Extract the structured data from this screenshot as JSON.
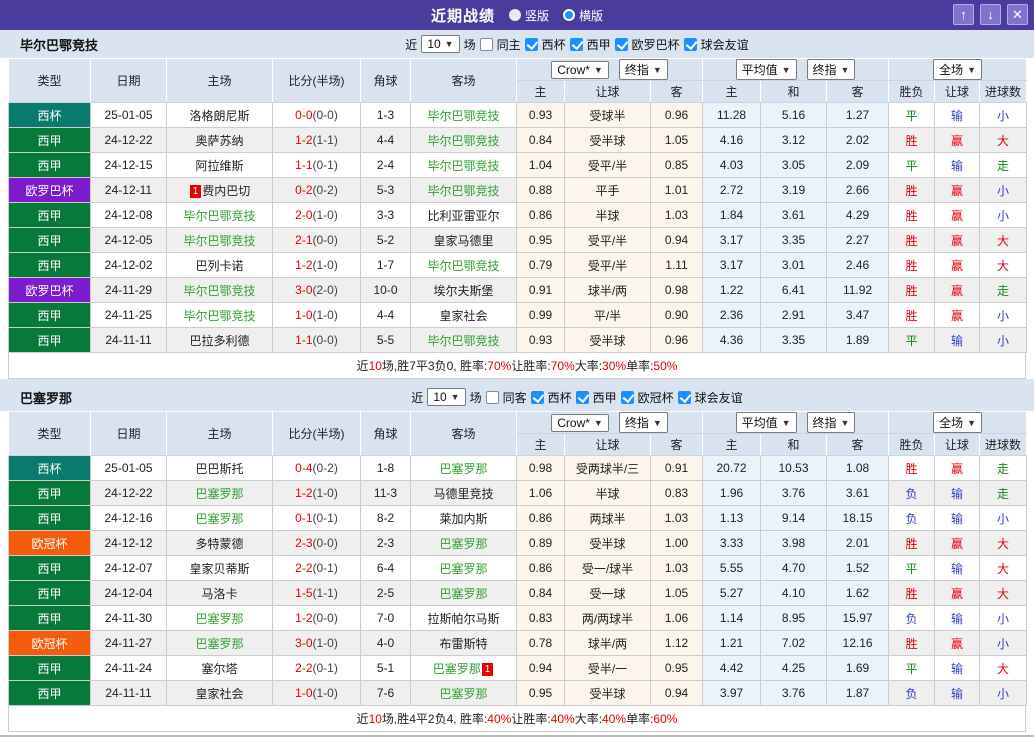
{
  "colors": {
    "titlebar": "#4a3c9c",
    "btn": "#8173cc",
    "btnbr": "#b6abe9",
    "strip": "#d9e4f0",
    "hdr": "#d9e3ef",
    "cup": "#0a7a6e",
    "liga": "#077a3a",
    "europa": "#7c1ccd",
    "ucl": "#f65c0d",
    "focus": "#35a033",
    "scred": "#e60000",
    "rred": "#e60012",
    "rblue": "#2f3fbf",
    "rgreen": "#15851d",
    "cream": "#fcf5ec",
    "lblue": "#eaf3fa",
    "alt": "#efefef"
  },
  "titlebar": {
    "title": "近期战绩",
    "radio_vertical": "竖版",
    "radio_horizontal": "横版",
    "up_icon": "↑",
    "down_icon": "↓",
    "close_icon": "✕"
  },
  "table_header": {
    "cols": [
      "类型",
      "日期",
      "主场",
      "比分(半场)",
      "角球",
      "客场"
    ],
    "dd_crow": "Crow*",
    "dd_final1": "终指",
    "dd_avg": "平均值",
    "dd_final2": "终指",
    "dd_full": "全场",
    "sub": [
      "主",
      "让球",
      "客",
      "主",
      "和",
      "客",
      "胜负",
      "让球",
      "进球数"
    ]
  },
  "sections": [
    {
      "team": "毕尔巴鄂竞技",
      "filter": {
        "near": "近",
        "count": "10",
        "games": "场",
        "same": "同主",
        "comps": [
          "西杯",
          "西甲",
          "欧罗巴杯",
          "球会友谊"
        ]
      },
      "rows": [
        {
          "type": "西杯",
          "tclass": "t-cup",
          "date": "25-01-05",
          "home": "洛格朗尼斯",
          "hbadge": "",
          "hclass": "",
          "score": "0-0",
          "half": "(0-0)",
          "corner": "1-3",
          "away": "毕尔巴鄂竞技",
          "abadge": "",
          "aclass": "focus",
          "h1": "0.93",
          "hd": "受球半",
          "h2": "0.96",
          "m1": "11.28",
          "m2": "5.16",
          "m3": "1.27",
          "r1": "平",
          "r1c": "green",
          "r2": "输",
          "r2c": "blue",
          "r3": "小",
          "r3c": "blue"
        },
        {
          "type": "西甲",
          "tclass": "t-liga",
          "date": "24-12-22",
          "home": "奥萨苏纳",
          "hbadge": "",
          "hclass": "",
          "score": "1-2",
          "half": "(1-1)",
          "corner": "4-4",
          "away": "毕尔巴鄂竞技",
          "abadge": "",
          "aclass": "focus",
          "h1": "0.84",
          "hd": "受半球",
          "h2": "1.05",
          "m1": "4.16",
          "m2": "3.12",
          "m3": "2.02",
          "r1": "胜",
          "r1c": "red",
          "r2": "赢",
          "r2c": "red",
          "r3": "大",
          "r3c": "red"
        },
        {
          "type": "西甲",
          "tclass": "t-liga",
          "date": "24-12-15",
          "home": "阿拉维斯",
          "hbadge": "",
          "hclass": "",
          "score": "1-1",
          "half": "(0-1)",
          "corner": "2-4",
          "away": "毕尔巴鄂竞技",
          "abadge": "",
          "aclass": "focus",
          "h1": "1.04",
          "hd": "受平/半",
          "h2": "0.85",
          "m1": "4.03",
          "m2": "3.05",
          "m3": "2.09",
          "r1": "平",
          "r1c": "green",
          "r2": "输",
          "r2c": "blue",
          "r3": "走",
          "r3c": "green"
        },
        {
          "type": "欧罗巴杯",
          "tclass": "t-europa",
          "date": "24-12-11",
          "home": "费内巴切",
          "hbadge": "1",
          "hclass": "",
          "score": "0-2",
          "half": "(0-2)",
          "corner": "5-3",
          "away": "毕尔巴鄂竞技",
          "abadge": "",
          "aclass": "focus",
          "h1": "0.88",
          "hd": "平手",
          "h2": "1.01",
          "m1": "2.72",
          "m2": "3.19",
          "m3": "2.66",
          "r1": "胜",
          "r1c": "red",
          "r2": "赢",
          "r2c": "red",
          "r3": "小",
          "r3c": "blue"
        },
        {
          "type": "西甲",
          "tclass": "t-liga",
          "date": "24-12-08",
          "home": "毕尔巴鄂竞技",
          "hbadge": "",
          "hclass": "focus",
          "score": "2-0",
          "half": "(1-0)",
          "corner": "3-3",
          "away": "比利亚雷亚尔",
          "abadge": "",
          "aclass": "",
          "h1": "0.86",
          "hd": "半球",
          "h2": "1.03",
          "m1": "1.84",
          "m2": "3.61",
          "m3": "4.29",
          "r1": "胜",
          "r1c": "red",
          "r2": "赢",
          "r2c": "red",
          "r3": "小",
          "r3c": "blue"
        },
        {
          "type": "西甲",
          "tclass": "t-liga",
          "date": "24-12-05",
          "home": "毕尔巴鄂竞技",
          "hbadge": "",
          "hclass": "focus",
          "score": "2-1",
          "half": "(0-0)",
          "corner": "5-2",
          "away": "皇家马德里",
          "abadge": "",
          "aclass": "",
          "h1": "0.95",
          "hd": "受平/半",
          "h2": "0.94",
          "m1": "3.17",
          "m2": "3.35",
          "m3": "2.27",
          "r1": "胜",
          "r1c": "red",
          "r2": "赢",
          "r2c": "red",
          "r3": "大",
          "r3c": "red"
        },
        {
          "type": "西甲",
          "tclass": "t-liga",
          "date": "24-12-02",
          "home": "巴列卡诺",
          "hbadge": "",
          "hclass": "",
          "score": "1-2",
          "half": "(1-0)",
          "corner": "1-7",
          "away": "毕尔巴鄂竞技",
          "abadge": "",
          "aclass": "focus",
          "h1": "0.79",
          "hd": "受平/半",
          "h2": "1.11",
          "m1": "3.17",
          "m2": "3.01",
          "m3": "2.46",
          "r1": "胜",
          "r1c": "red",
          "r2": "赢",
          "r2c": "red",
          "r3": "大",
          "r3c": "red"
        },
        {
          "type": "欧罗巴杯",
          "tclass": "t-europa",
          "date": "24-11-29",
          "home": "毕尔巴鄂竞技",
          "hbadge": "",
          "hclass": "focus",
          "score": "3-0",
          "half": "(2-0)",
          "corner": "10-0",
          "away": "埃尔夫斯堡",
          "abadge": "",
          "aclass": "",
          "h1": "0.91",
          "hd": "球半/两",
          "h2": "0.98",
          "m1": "1.22",
          "m2": "6.41",
          "m3": "11.92",
          "r1": "胜",
          "r1c": "red",
          "r2": "赢",
          "r2c": "red",
          "r3": "走",
          "r3c": "green"
        },
        {
          "type": "西甲",
          "tclass": "t-liga",
          "date": "24-11-25",
          "home": "毕尔巴鄂竞技",
          "hbadge": "",
          "hclass": "focus",
          "score": "1-0",
          "half": "(1-0)",
          "corner": "4-4",
          "away": "皇家社会",
          "abadge": "",
          "aclass": "",
          "h1": "0.99",
          "hd": "平/半",
          "h2": "0.90",
          "m1": "2.36",
          "m2": "2.91",
          "m3": "3.47",
          "r1": "胜",
          "r1c": "red",
          "r2": "赢",
          "r2c": "red",
          "r3": "小",
          "r3c": "blue"
        },
        {
          "type": "西甲",
          "tclass": "t-liga",
          "date": "24-11-11",
          "home": "巴拉多利德",
          "hbadge": "",
          "hclass": "",
          "score": "1-1",
          "half": "(0-0)",
          "corner": "5-5",
          "away": "毕尔巴鄂竞技",
          "abadge": "",
          "aclass": "focus",
          "h1": "0.93",
          "hd": "受半球",
          "h2": "0.96",
          "m1": "4.36",
          "m2": "3.35",
          "m3": "1.89",
          "r1": "平",
          "r1c": "green",
          "r2": "输",
          "r2c": "blue",
          "r3": "小",
          "r3c": "blue"
        }
      ],
      "summary": [
        {
          "t": "近"
        },
        {
          "t": "10",
          "red": true
        },
        {
          "t": "场,胜7平3负0, 胜率:"
        },
        {
          "t": "70%",
          "red": true
        },
        {
          "t": " 让胜率:"
        },
        {
          "t": "70%",
          "red": true
        },
        {
          "t": " 大率:"
        },
        {
          "t": "30%",
          "red": true
        },
        {
          "t": " 单率:"
        },
        {
          "t": "50%",
          "red": true
        }
      ]
    },
    {
      "team": "巴塞罗那",
      "filter": {
        "near": "近",
        "count": "10",
        "games": "场",
        "same": "同客",
        "comps": [
          "西杯",
          "西甲",
          "欧冠杯",
          "球会友谊"
        ]
      },
      "rows": [
        {
          "type": "西杯",
          "tclass": "t-cup",
          "date": "25-01-05",
          "home": "巴巴斯托",
          "hbadge": "",
          "hclass": "",
          "score": "0-4",
          "half": "(0-2)",
          "corner": "1-8",
          "away": "巴塞罗那",
          "abadge": "",
          "aclass": "focus",
          "h1": "0.98",
          "hd": "受两球半/三",
          "h2": "0.91",
          "m1": "20.72",
          "m2": "10.53",
          "m3": "1.08",
          "r1": "胜",
          "r1c": "red",
          "r2": "赢",
          "r2c": "red",
          "r3": "走",
          "r3c": "green"
        },
        {
          "type": "西甲",
          "tclass": "t-liga",
          "date": "24-12-22",
          "home": "巴塞罗那",
          "hbadge": "",
          "hclass": "focus",
          "score": "1-2",
          "half": "(1-0)",
          "corner": "11-3",
          "away": "马德里竞技",
          "abadge": "",
          "aclass": "",
          "h1": "1.06",
          "hd": "半球",
          "h2": "0.83",
          "m1": "1.96",
          "m2": "3.76",
          "m3": "3.61",
          "r1": "负",
          "r1c": "blue",
          "r2": "输",
          "r2c": "blue",
          "r3": "走",
          "r3c": "green"
        },
        {
          "type": "西甲",
          "tclass": "t-liga",
          "date": "24-12-16",
          "home": "巴塞罗那",
          "hbadge": "",
          "hclass": "focus",
          "score": "0-1",
          "half": "(0-1)",
          "corner": "8-2",
          "away": "莱加内斯",
          "abadge": "",
          "aclass": "",
          "h1": "0.86",
          "hd": "两球半",
          "h2": "1.03",
          "m1": "1.13",
          "m2": "9.14",
          "m3": "18.15",
          "r1": "负",
          "r1c": "blue",
          "r2": "输",
          "r2c": "blue",
          "r3": "小",
          "r3c": "blue"
        },
        {
          "type": "欧冠杯",
          "tclass": "t-ucl",
          "date": "24-12-12",
          "home": "多特蒙德",
          "hbadge": "",
          "hclass": "",
          "score": "2-3",
          "half": "(0-0)",
          "corner": "2-3",
          "away": "巴塞罗那",
          "abadge": "",
          "aclass": "focus",
          "h1": "0.89",
          "hd": "受半球",
          "h2": "1.00",
          "m1": "3.33",
          "m2": "3.98",
          "m3": "2.01",
          "r1": "胜",
          "r1c": "red",
          "r2": "赢",
          "r2c": "red",
          "r3": "大",
          "r3c": "red"
        },
        {
          "type": "西甲",
          "tclass": "t-liga",
          "date": "24-12-07",
          "home": "皇家贝蒂斯",
          "hbadge": "",
          "hclass": "",
          "score": "2-2",
          "half": "(0-1)",
          "corner": "6-4",
          "away": "巴塞罗那",
          "abadge": "",
          "aclass": "focus",
          "h1": "0.86",
          "hd": "受一/球半",
          "h2": "1.03",
          "m1": "5.55",
          "m2": "4.70",
          "m3": "1.52",
          "r1": "平",
          "r1c": "green",
          "r2": "输",
          "r2c": "blue",
          "r3": "大",
          "r3c": "red"
        },
        {
          "type": "西甲",
          "tclass": "t-liga",
          "date": "24-12-04",
          "home": "马洛卡",
          "hbadge": "",
          "hclass": "",
          "score": "1-5",
          "half": "(1-1)",
          "corner": "2-5",
          "away": "巴塞罗那",
          "abadge": "",
          "aclass": "focus",
          "h1": "0.84",
          "hd": "受一球",
          "h2": "1.05",
          "m1": "5.27",
          "m2": "4.10",
          "m3": "1.62",
          "r1": "胜",
          "r1c": "red",
          "r2": "赢",
          "r2c": "red",
          "r3": "大",
          "r3c": "red"
        },
        {
          "type": "西甲",
          "tclass": "t-liga",
          "date": "24-11-30",
          "home": "巴塞罗那",
          "hbadge": "",
          "hclass": "focus",
          "score": "1-2",
          "half": "(0-0)",
          "corner": "7-0",
          "away": "拉斯帕尔马斯",
          "abadge": "",
          "aclass": "",
          "h1": "0.83",
          "hd": "两/两球半",
          "h2": "1.06",
          "m1": "1.14",
          "m2": "8.95",
          "m3": "15.97",
          "r1": "负",
          "r1c": "blue",
          "r2": "输",
          "r2c": "blue",
          "r3": "小",
          "r3c": "blue"
        },
        {
          "type": "欧冠杯",
          "tclass": "t-ucl",
          "date": "24-11-27",
          "home": "巴塞罗那",
          "hbadge": "",
          "hclass": "focus",
          "score": "3-0",
          "half": "(1-0)",
          "corner": "4-0",
          "away": "布雷斯特",
          "abadge": "",
          "aclass": "",
          "h1": "0.78",
          "hd": "球半/两",
          "h2": "1.12",
          "m1": "1.21",
          "m2": "7.02",
          "m3": "12.16",
          "r1": "胜",
          "r1c": "red",
          "r2": "赢",
          "r2c": "red",
          "r3": "小",
          "r3c": "blue"
        },
        {
          "type": "西甲",
          "tclass": "t-liga",
          "date": "24-11-24",
          "home": "塞尔塔",
          "hbadge": "",
          "hclass": "",
          "score": "2-2",
          "half": "(0-1)",
          "corner": "5-1",
          "away": "巴塞罗那",
          "abadge": "1",
          "aclass": "focus",
          "h1": "0.94",
          "hd": "受半/一",
          "h2": "0.95",
          "m1": "4.42",
          "m2": "4.25",
          "m3": "1.69",
          "r1": "平",
          "r1c": "green",
          "r2": "输",
          "r2c": "blue",
          "r3": "大",
          "r3c": "red"
        },
        {
          "type": "西甲",
          "tclass": "t-liga",
          "date": "24-11-11",
          "home": "皇家社会",
          "hbadge": "",
          "hclass": "",
          "score": "1-0",
          "half": "(1-0)",
          "corner": "7-6",
          "away": "巴塞罗那",
          "abadge": "",
          "aclass": "focus",
          "h1": "0.95",
          "hd": "受半球",
          "h2": "0.94",
          "m1": "3.97",
          "m2": "3.76",
          "m3": "1.87",
          "r1": "负",
          "r1c": "blue",
          "r2": "输",
          "r2c": "blue",
          "r3": "小",
          "r3c": "blue"
        }
      ],
      "summary": [
        {
          "t": "近"
        },
        {
          "t": "10",
          "red": true
        },
        {
          "t": "场,胜4平2负4, 胜率:"
        },
        {
          "t": "40%",
          "red": true
        },
        {
          "t": " 让胜率:"
        },
        {
          "t": "40%",
          "red": true
        },
        {
          "t": " 大率:"
        },
        {
          "t": "40%",
          "red": true
        },
        {
          "t": " 单率:"
        },
        {
          "t": "60%",
          "red": true
        }
      ]
    }
  ]
}
